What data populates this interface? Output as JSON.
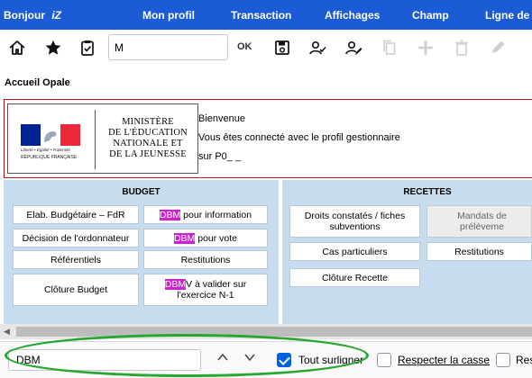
{
  "menu": {
    "greeting": "Bonjour",
    "greeting_logo": "iZ",
    "items": [
      "Mon profil",
      "Transaction",
      "Affichages",
      "Champ",
      "Ligne de de"
    ]
  },
  "toolbar": {
    "search_value": "M",
    "ok_label": "OK",
    "icons": [
      "home-icon",
      "star-icon",
      "clipboard-check-icon",
      "save-icon",
      "user-check-icon",
      "user-edit-icon",
      "copy-icon",
      "plus-icon",
      "trash-icon",
      "pen-icon"
    ]
  },
  "page_title": "Accueil Opale",
  "welcome": {
    "logo": {
      "marianne": "Liberté • Égalité • Fraternité",
      "republic": "RÉPUBLIQUE FRANÇAISE",
      "ministry_lines": [
        "MINISTÈRE",
        "DE L'ÉDUCATION",
        "NATIONALE ET",
        "DE LA JEUNESSE"
      ]
    },
    "line1": "Bienvenue",
    "line2": "Vous êtes connecté avec le profil gestionnaire",
    "line3": "sur P0_ _"
  },
  "budget": {
    "title": "BUDGET",
    "elab": "Elab. Budgétaire – FdR",
    "dbm_word": "DBM",
    "dbm_info_rest": " pour information",
    "decision": "Décision de l'ordonnateur",
    "dbm_vote_rest": " pour vote",
    "referentiels": "Référentiels",
    "restitutions": "Restitutions",
    "cloture": "Clôture Budget",
    "dbm_valider_first": "V à valider sur",
    "dbm_valider_second": "l'exercice N-1"
  },
  "recettes": {
    "title": "RECETTES",
    "droits": "Droits constatés / fiches subventions",
    "mandats": "Mandats de prélèveme",
    "cas": "Cas particuliers",
    "restitutions": "Restitutions",
    "cloture": "Clôture Recette"
  },
  "findbar": {
    "query": "DBM",
    "highlight_all_label": "Tout surligner",
    "highlight_all_checked": true,
    "match_case_label": "Respecter la casse",
    "next_label_partial": "Res"
  },
  "colors": {
    "menubar": "#1c5bd6",
    "panel": "#c7ddef",
    "highlight": "#d21ed2",
    "annotation_ellipse": "#25a82e"
  }
}
